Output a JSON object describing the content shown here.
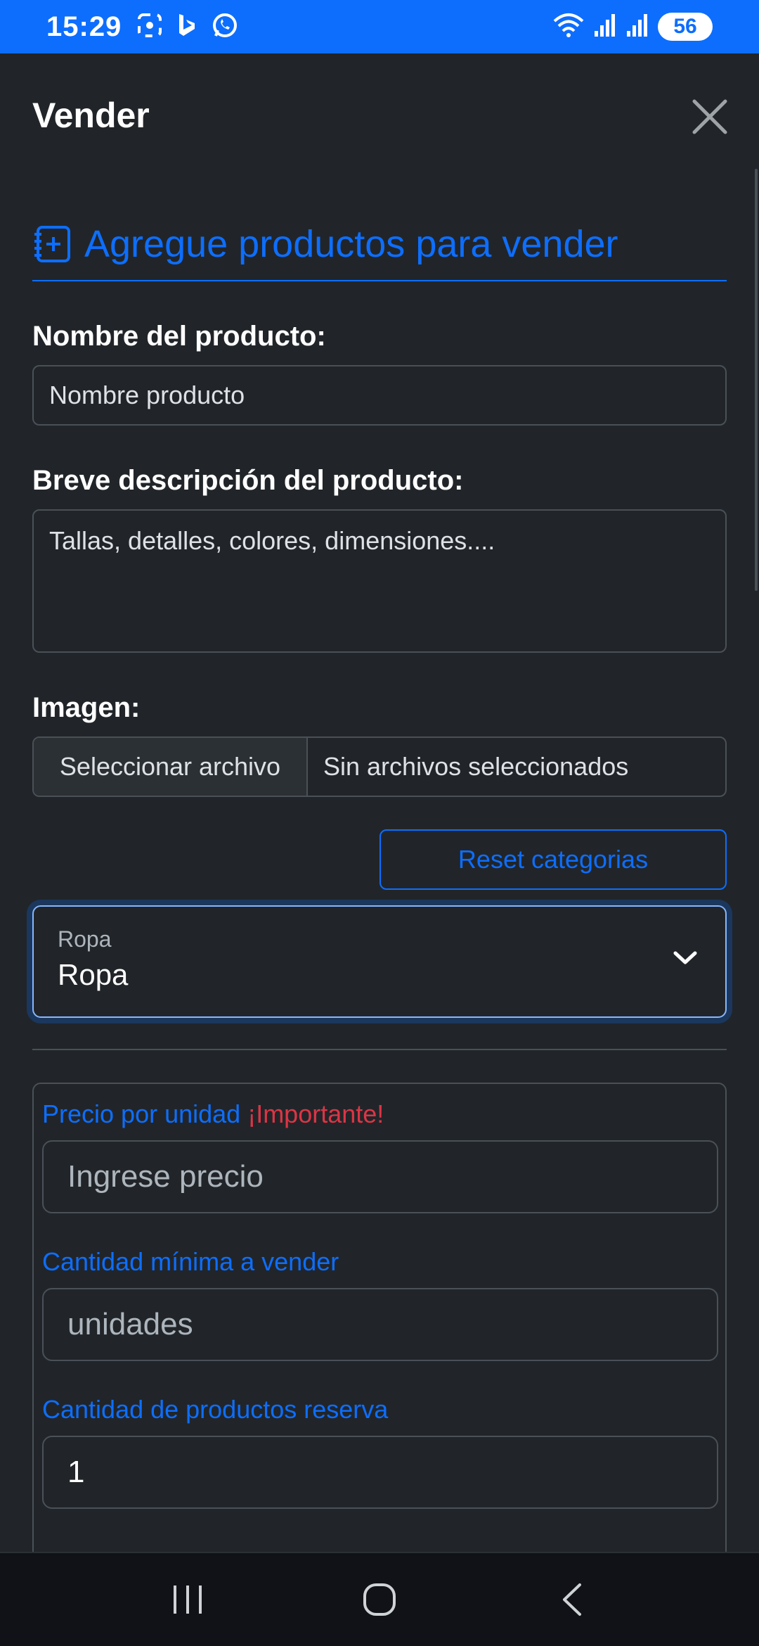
{
  "status_bar": {
    "time": "15:29",
    "battery": "56",
    "left_icons": [
      "screenshot-icon",
      "bing-icon",
      "whatsapp-icon"
    ],
    "right_icons": [
      "wifi-icon",
      "signal-icon",
      "signal-icon",
      "battery-icon"
    ]
  },
  "header": {
    "title": "Vender",
    "close_icon": "close-icon"
  },
  "form": {
    "section_title": "Agregue productos para vender",
    "section_icon": "add-notebook-icon",
    "name_label": "Nombre del producto:",
    "name_placeholder": "Nombre producto",
    "description_label": "Breve descripción del producto:",
    "description_placeholder": "Tallas, detalles, colores, dimensiones....",
    "image_label": "Imagen:",
    "file_button": "Seleccionar archivo",
    "file_status": "Sin archivos seleccionados",
    "reset_button": "Reset categorias",
    "category_select": {
      "label": "Ropa",
      "value": "Ropa",
      "icon": "chevron-down-icon"
    }
  },
  "pricing": {
    "price_label": "Precio por unidad",
    "price_important": "¡Importante!",
    "price_placeholder": "Ingrese precio",
    "min_qty_label": "Cantidad mínima a vender",
    "min_qty_placeholder": "unidades",
    "reserve_label": "Cantidad de productos reserva",
    "reserve_value": "1"
  },
  "colors": {
    "primary": "#0d6efd",
    "danger": "#dc3545",
    "background": "#212529"
  },
  "navbar": {
    "icons": [
      "recent-apps-icon",
      "home-icon",
      "back-icon"
    ]
  }
}
